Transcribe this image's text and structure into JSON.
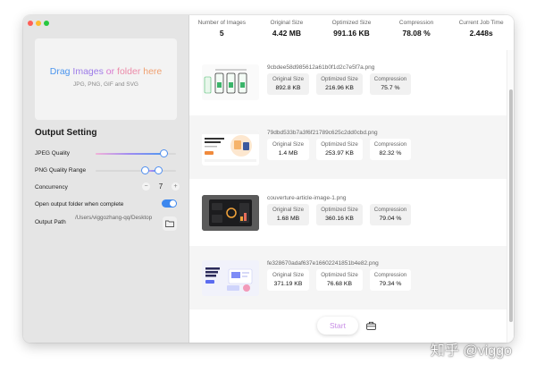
{
  "sidebar": {
    "dropzone": {
      "title_words": [
        "Drag",
        "Images",
        "or",
        "folder",
        "here"
      ],
      "subtitle": "JPG, PNG, GIF and SVG"
    },
    "section_title": "Output Setting",
    "jpeg_quality": {
      "label": "JPEG Quality",
      "value_fraction": 0.85
    },
    "png_quality_range": {
      "label": "PNG Quality Range",
      "low_fraction": 0.62,
      "high_fraction": 0.78
    },
    "concurrency": {
      "label": "Concurrency",
      "value": "7",
      "minus": "−",
      "plus": "+"
    },
    "open_folder": {
      "label": "Open output folder when complete",
      "on": true
    },
    "output_path": {
      "label": "Output Path",
      "value": "/Users/viggozhang-qq/Desktop"
    }
  },
  "stats": [
    {
      "label": "Number of Images",
      "value": "5"
    },
    {
      "label": "Original Size",
      "value": "4.42 MB"
    },
    {
      "label": "Optimized Size",
      "value": "991.16 KB"
    },
    {
      "label": "Compression",
      "value": "78.08 %"
    },
    {
      "label": "Current Job Time",
      "value": "2.448s"
    }
  ],
  "column_labels": {
    "original": "Original Size",
    "optimized": "Optimized Size",
    "compression": "Compression"
  },
  "files": [
    {
      "name": "9cbdee58d985612a61b0f1d2c7e5f7a.png",
      "original": "892.8 KB",
      "optimized": "216.96 KB",
      "compression": "75.7 %"
    },
    {
      "name": "79dbd533b7a3f6f21789c625c2dd0cbd.png",
      "original": "1.4 MB",
      "optimized": "253.97 KB",
      "compression": "82.32 %"
    },
    {
      "name": "couverture-article-image-1.png",
      "original": "1.68 MB",
      "optimized": "360.16 KB",
      "compression": "79.04 %"
    },
    {
      "name": "fe328670adaf637e16602241851b4e82.png",
      "original": "371.19 KB",
      "optimized": "76.68 KB",
      "compression": "79.34 %"
    }
  ],
  "actions": {
    "start": "Start",
    "tool_icon": "toolbox-icon"
  },
  "watermark": "知乎 @viggo",
  "colors": {
    "accent": "#3c87ee",
    "start_text": "#c88de6",
    "sidebar_bg": "#e5e5e5"
  }
}
